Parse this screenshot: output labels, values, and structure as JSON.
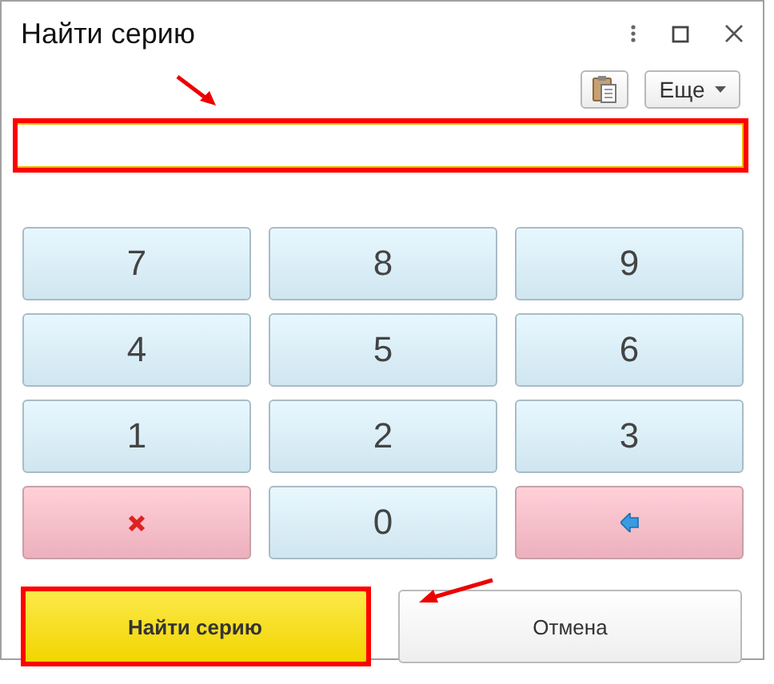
{
  "window": {
    "title": "Найти серию"
  },
  "toolbar": {
    "more_button": "Еще"
  },
  "field": {
    "highlighted": true
  },
  "keypad": [
    {
      "kind": "digit",
      "label": "7"
    },
    {
      "kind": "digit",
      "label": "8"
    },
    {
      "kind": "digit",
      "label": "9"
    },
    {
      "kind": "digit",
      "label": "4"
    },
    {
      "kind": "digit",
      "label": "5"
    },
    {
      "kind": "digit",
      "label": "6"
    },
    {
      "kind": "digit",
      "label": "1"
    },
    {
      "kind": "digit",
      "label": "2"
    },
    {
      "kind": "digit",
      "label": "3"
    },
    {
      "kind": "clear"
    },
    {
      "kind": "digit",
      "label": "0"
    },
    {
      "kind": "backspace"
    }
  ],
  "buttons": [
    {
      "kind": "primary",
      "label": "Найти серию",
      "highlighted": true
    },
    {
      "kind": "secondary",
      "label": "Отмена",
      "highlighted": false
    }
  ]
}
